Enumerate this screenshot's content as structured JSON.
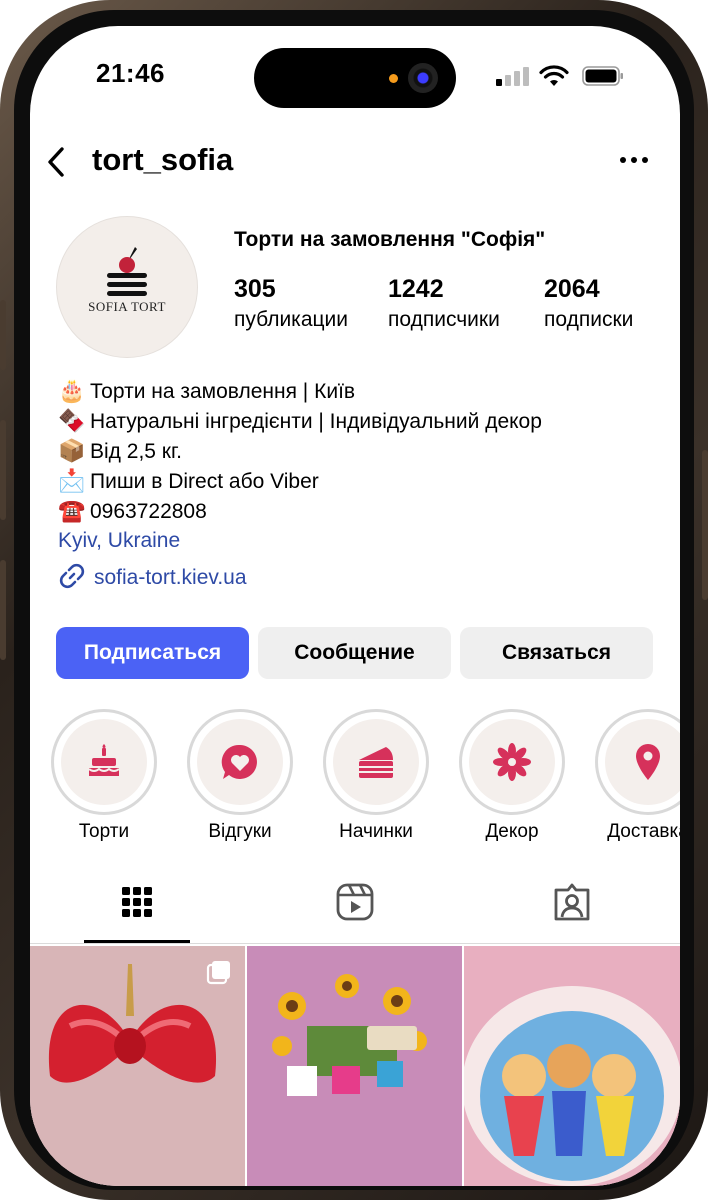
{
  "status_bar": {
    "time": "21:46"
  },
  "header": {
    "username": "tort_sofia"
  },
  "profile": {
    "avatar_text": "SOFIA TORT",
    "display_name": "Торти на замовлення \"Софія\"",
    "stats": [
      {
        "value": "305",
        "label": "публикации"
      },
      {
        "value": "1242",
        "label": "подписчики"
      },
      {
        "value": "2064",
        "label": "подписки"
      }
    ]
  },
  "bio": {
    "lines": [
      {
        "emoji": "🎂",
        "text": "Торти на замовлення | Київ"
      },
      {
        "emoji": "🍫",
        "text": "Натуральні інгредієнти | Індивідуальний декор"
      },
      {
        "emoji": "📦",
        "text": "Від 2,5 кг."
      },
      {
        "emoji": "📩",
        "text": "Пиши в Direct або Viber"
      },
      {
        "emoji": "☎️",
        "text": "0963722808"
      }
    ],
    "location": "Kyiv, Ukraine",
    "link": "sofia-tort.kiev.ua"
  },
  "actions": {
    "follow": "Подписаться",
    "message": "Сообщение",
    "contact": "Связаться"
  },
  "highlights": [
    {
      "label": "Торти",
      "icon": "cake-icon"
    },
    {
      "label": "Відгуки",
      "icon": "chat-heart-icon"
    },
    {
      "label": "Начинки",
      "icon": "cake-slice-icon"
    },
    {
      "label": "Декор",
      "icon": "flower-icon"
    },
    {
      "label": "Доставка",
      "icon": "location-pin-icon"
    }
  ],
  "tabs": [
    {
      "name": "grid",
      "icon": "grid-icon",
      "selected": true
    },
    {
      "name": "reels",
      "icon": "reels-icon",
      "selected": false
    },
    {
      "name": "tagged",
      "icon": "tagged-user-icon",
      "selected": false
    }
  ],
  "colors": {
    "accent": "#4b62f5",
    "link": "#2e4aa6",
    "highlight_icon": "#d6315b",
    "secondary_button": "#efefef"
  }
}
